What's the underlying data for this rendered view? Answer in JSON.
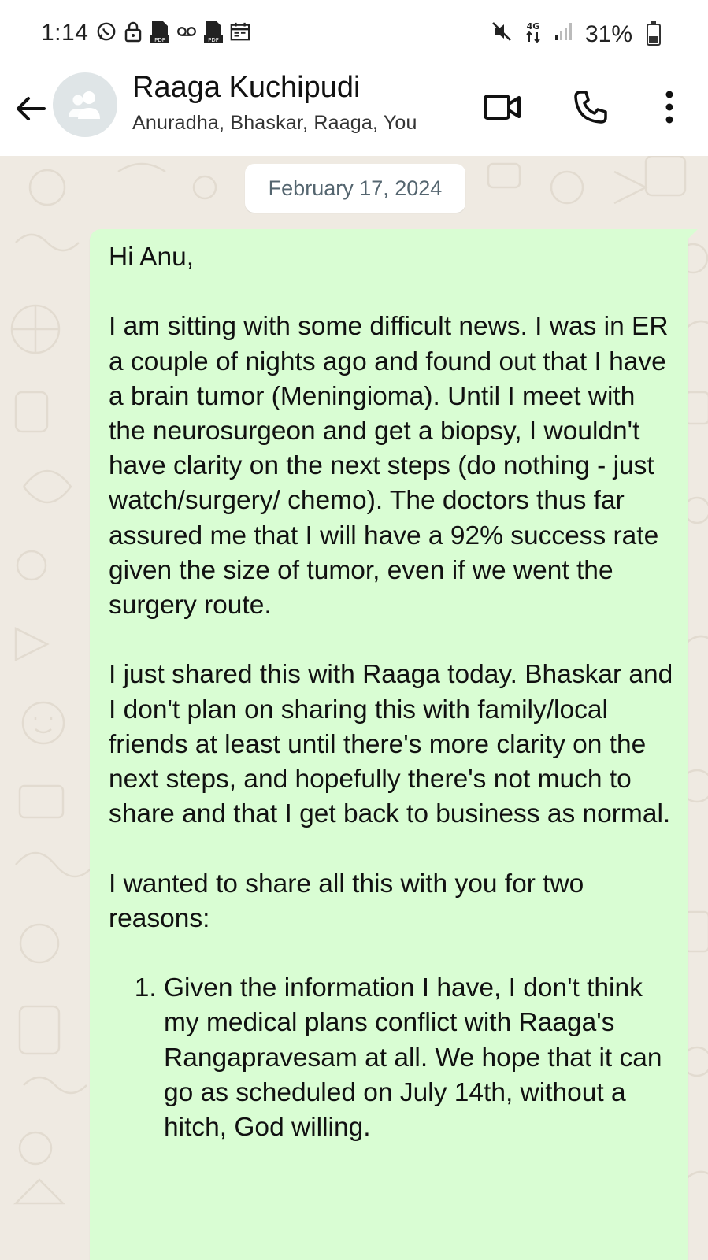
{
  "status_bar": {
    "time": "1:14",
    "battery": "31%",
    "left_icons": [
      "whatsapp-icon",
      "lock-icon",
      "pdf-icon",
      "voicemail-icon",
      "pdf-icon",
      "calendar-icon"
    ],
    "right_icons": [
      "mute-icon",
      "data-4g-icon",
      "signal-icon",
      "battery-icon"
    ]
  },
  "header": {
    "title": "Raaga Kuchipudi",
    "participants": "Anuradha, Bhaskar, Raaga, You"
  },
  "chat": {
    "date_label": "February 17, 2024",
    "message": {
      "greeting": "Hi Anu,",
      "para1": "I am sitting with some difficult news. I was in ER a couple of nights ago and found out that I have a brain tumor (Meningioma). Until I meet with the neurosurgeon and get a biopsy, I wouldn't have clarity on the next steps (do nothing - just watch/surgery/ chemo). The doctors thus far assured me that I will have a 92% success rate given the size of tumor, even if we went the surgery route.",
      "para2": "I just shared this with Raaga today. Bhaskar and I don't plan on sharing this with family/local friends at least until there's more clarity on the next steps, and hopefully there's not much to share and that I get back to business as normal.",
      "para3": "I wanted to share all this with you for two reasons:",
      "list": [
        "Given the information I have, I don't think my medical plans conflict with Raaga's Rangapravesam at all. We hope that it can go as scheduled on July 14th, without a hitch, God willing."
      ]
    }
  },
  "colors": {
    "bubble": "#d9fdd3",
    "chat_bg": "#efeae2",
    "date_text": "#54656f"
  }
}
